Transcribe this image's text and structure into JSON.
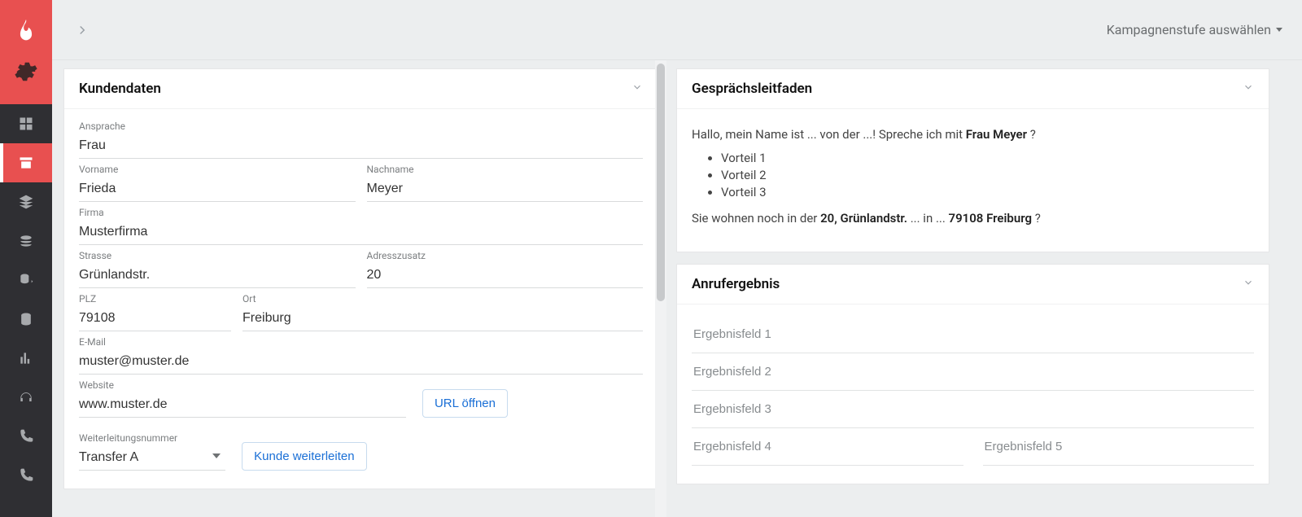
{
  "topbar": {
    "stage_select_label": "Kampagnenstufe auswählen"
  },
  "panels": {
    "customer_title": "Kundendaten",
    "script_title": "Gesprächsleitfaden",
    "result_title": "Anrufergebnis"
  },
  "customer": {
    "labels": {
      "anrede": "Ansprache",
      "vorname": "Vorname",
      "nachname": "Nachname",
      "firma": "Firma",
      "strasse": "Strasse",
      "adresszusatz": "Adresszusatz",
      "plz": "PLZ",
      "ort": "Ort",
      "email": "E-Mail",
      "website": "Website",
      "weiterleitung": "Weiterleitungsnummer"
    },
    "values": {
      "anrede": "Frau",
      "vorname": "Frieda",
      "nachname": "Meyer",
      "firma": "Musterfirma",
      "strasse": "Grünlandstr.",
      "adresszusatz": "20",
      "plz": "79108",
      "ort": "Freiburg",
      "email": "muster@muster.de",
      "website": "www.muster.de",
      "weiterleitung": "Transfer A"
    },
    "buttons": {
      "url_open": "URL öffnen",
      "forward": "Kunde weiterleiten"
    }
  },
  "script": {
    "line1_pre": "Hallo, mein Name ist ... von der ...! Spreche ich mit ",
    "line1_bold": "Frau Meyer",
    "line1_post": " ?",
    "bullets": [
      "Vorteil 1",
      "Vorteil 2",
      "Vorteil 3"
    ],
    "line2_pre": "Sie wohnen noch in der ",
    "line2_b1": "20, Grünlandstr.",
    "line2_mid": " ... in ... ",
    "line2_b2": "79108 Freiburg",
    "line2_post": " ?"
  },
  "results": {
    "placeholders": [
      "Ergebnisfeld 1",
      "Ergebnisfeld 2",
      "Ergebnisfeld 3",
      "Ergebnisfeld 4",
      "Ergebnisfeld 5"
    ]
  },
  "sidebar": {
    "icons": [
      "dashboard",
      "archive",
      "layers",
      "coins-in",
      "db-out",
      "db",
      "chart",
      "headphones",
      "phone",
      "phone-in"
    ]
  }
}
